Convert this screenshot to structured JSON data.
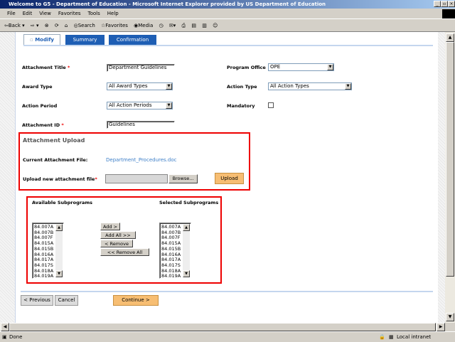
{
  "window": {
    "title": "Welcome to G5 - Department of Education - Microsoft Internet Explorer provided by US Department of Education"
  },
  "menu": [
    "File",
    "Edit",
    "View",
    "Favorites",
    "Tools",
    "Help"
  ],
  "toolbar": {
    "back": "Back",
    "search": "Search",
    "favorites": "Favorites",
    "media": "Media"
  },
  "tabs": [
    {
      "label": "Modify",
      "active": true
    },
    {
      "label": "Summary"
    },
    {
      "label": "Confirmation"
    }
  ],
  "form": {
    "attachment_title": {
      "label": "Attachment Title",
      "value": "Department Guidelines"
    },
    "award_type": {
      "label": "Award Type",
      "value": "All Award Types"
    },
    "action_period": {
      "label": "Action Period",
      "value": "All Action Periods"
    },
    "attachment_id": {
      "label": "Attachment ID",
      "value": "Guidelines"
    },
    "program_office": {
      "label": "Program Office",
      "value": "OPE"
    },
    "action_type": {
      "label": "Action Type",
      "value": "All Action Types"
    },
    "mandatory": {
      "label": "Mandatory",
      "checked": false
    },
    "required_mark": "*"
  },
  "upload": {
    "heading": "Attachment Upload",
    "current_label": "Current Attachment File:",
    "current_file": "Department_Procedures.doc",
    "new_label": "Upload new attachment file",
    "browse": "Browse...",
    "upload": "Upload"
  },
  "subprograms": {
    "available_label": "Available Subprograms",
    "selected_label": "Selected Subprograms",
    "available": [
      "84.007A",
      "84.007B",
      "84.007F",
      "84.015A",
      "84.015B",
      "84.016A",
      "84.017A",
      "84.017S",
      "84.018A",
      "84.019A"
    ],
    "selected": [
      "84.007A",
      "84.007B",
      "84.007F",
      "84.015A",
      "84.015B",
      "84.016A",
      "84.017A",
      "84.017S",
      "84.018A",
      "84.019A"
    ],
    "add": "Add >",
    "add_all": "Add All >>",
    "remove": "< Remove",
    "remove_all": "<< Remove All"
  },
  "footer": {
    "previous": "< Previous",
    "cancel": "Cancel",
    "continue": "Continue >"
  },
  "status": {
    "text": "Done",
    "zone": "Local intranet"
  }
}
